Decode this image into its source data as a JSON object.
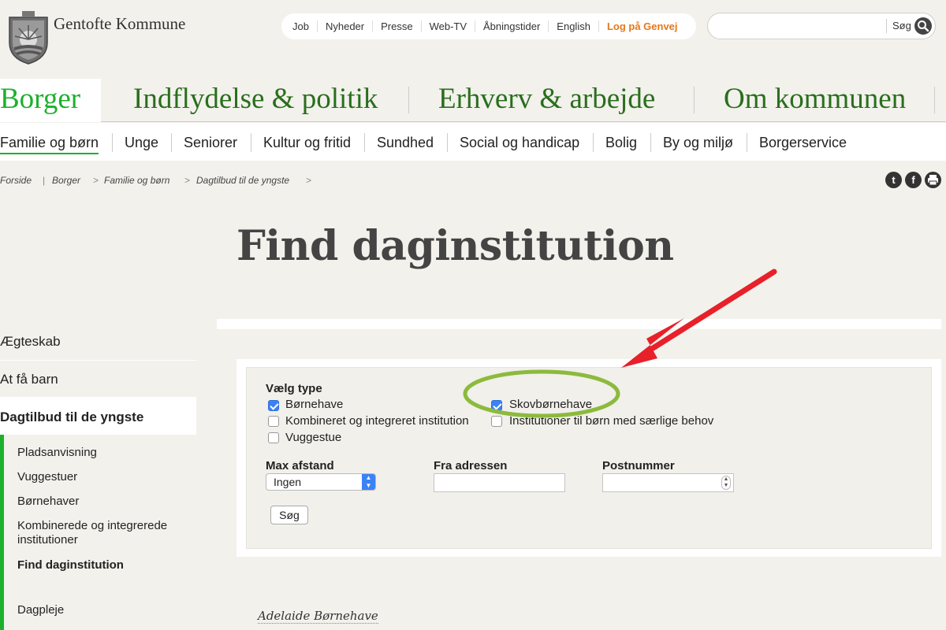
{
  "header": {
    "brand": "Gentofte Kommune",
    "top_links": [
      "Job",
      "Nyheder",
      "Presse",
      "Web-TV",
      "Åbningstider",
      "English",
      "Log på Genvej"
    ],
    "search": {
      "value": "",
      "label": "Søg",
      "icon": "search-icon"
    }
  },
  "main_nav": [
    "Borger",
    "Indflydelse & politik",
    "Erhverv & arbejde",
    "Om kommunen"
  ],
  "sub_nav": [
    "Familie og børn",
    "Unge",
    "Seniorer",
    "Kultur og fritid",
    "Sundhed",
    "Social og handicap",
    "Bolig",
    "By og miljø",
    "Borgerservice"
  ],
  "breadcrumb": [
    "Forside",
    "Borger",
    "Familie og børn",
    "Dagtilbud til de yngste"
  ],
  "breadcrumb_seps": [
    "|",
    ">",
    ">",
    ">"
  ],
  "social": [
    "twitter-icon",
    "facebook-icon",
    "print-icon"
  ],
  "page_title": "Find daginstitution",
  "left_menu": {
    "items": [
      "Ægteskab",
      "At få barn",
      "Dagtilbud til de yngste"
    ],
    "subitems": [
      "Pladsanvisning",
      "Vuggestuer",
      "Børnehaver",
      "Kombinerede og integrerede institutioner",
      "Find daginstitution",
      "Dagpleje"
    ]
  },
  "form": {
    "type_label": "Vælg type",
    "types": [
      {
        "label": "Børnehave",
        "checked": true
      },
      {
        "label": "Kombineret og integreret institution",
        "checked": false
      },
      {
        "label": "Vuggestue",
        "checked": false
      },
      {
        "label": "Skovbørnehave",
        "checked": true
      },
      {
        "label": "Institutioner til børn med særlige behov",
        "checked": false
      }
    ],
    "distance_label": "Max afstand",
    "distance_value": "Ingen",
    "address_label": "Fra adressen",
    "address_value": "",
    "postcode_label": "Postnummer",
    "postcode_value": "",
    "submit_label": "Søg"
  },
  "results": [
    "Adelaide Børnehave"
  ],
  "annotation_colors": {
    "arrow": "#e8202a",
    "ellipse": "#8cba3c"
  },
  "colors": {
    "brand_green": "#2a6e1d",
    "accent_green": "#1cb12c",
    "link_orange": "#e3781c",
    "checkbox_blue": "#3b82f6"
  }
}
